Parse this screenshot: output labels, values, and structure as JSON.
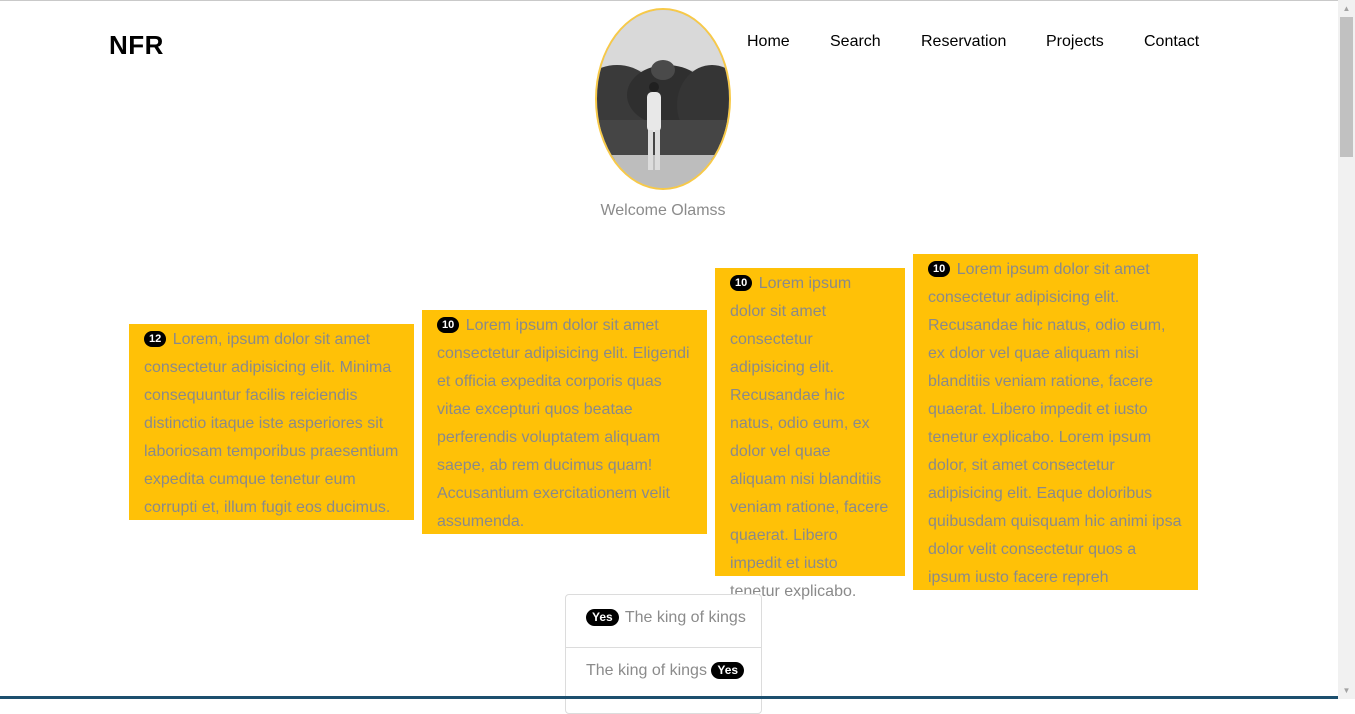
{
  "brand": "NFR",
  "nav": [
    {
      "label": "Home"
    },
    {
      "label": "Search"
    },
    {
      "label": "Reservation"
    },
    {
      "label": "Projects"
    },
    {
      "label": "Contact"
    }
  ],
  "profile": {
    "welcome": "Welcome Olamss"
  },
  "cards": [
    {
      "badge": "12",
      "text": "Lorem, ipsum dolor sit amet consectetur adipisicing elit. Minima consequuntur facilis reiciendis distinctio itaque iste asperiores sit laboriosam temporibus praesentium expedita cumque tenetur eum corrupti et, illum fugit eos ducimus."
    },
    {
      "badge": "10",
      "text": "Lorem ipsum dolor sit amet consectetur adipisicing elit. Eligendi et officia expedita corporis quas vitae excepturi quos beatae perferendis voluptatem aliquam saepe, ab rem ducimus quam! Accusantium exercitationem velit assumenda."
    },
    {
      "badge": "10",
      "text": "Lorem ipsum dolor sit amet consectetur adipisicing elit. Recusandae hic natus, odio eum, ex dolor vel quae aliquam nisi blanditiis veniam ratione, facere quaerat. Libero impedit et iusto tenetur explicabo."
    },
    {
      "badge": "10",
      "text": "Lorem ipsum dolor sit amet consectetur adipisicing elit. Recusandae hic natus, odio eum, ex dolor vel quae aliquam nisi blanditiis veniam ratione, facere quaerat. Libero impedit et iusto tenetur explicabo. Lorem ipsum dolor, sit amet consectetur adipisicing elit. Eaque doloribus quibusdam quisquam hic animi ipsa dolor velit consectetur quos a ipsum iusto facere repreh"
    }
  ],
  "list": [
    {
      "badge": "Yes",
      "text": "The king of kings"
    },
    {
      "text": "The king of kings",
      "badge": "Yes"
    }
  ],
  "colors": {
    "accent": "#ffc107",
    "avatar_border": "#f7c948",
    "badge_bg": "#000000",
    "muted_text": "#8a8a8a"
  }
}
